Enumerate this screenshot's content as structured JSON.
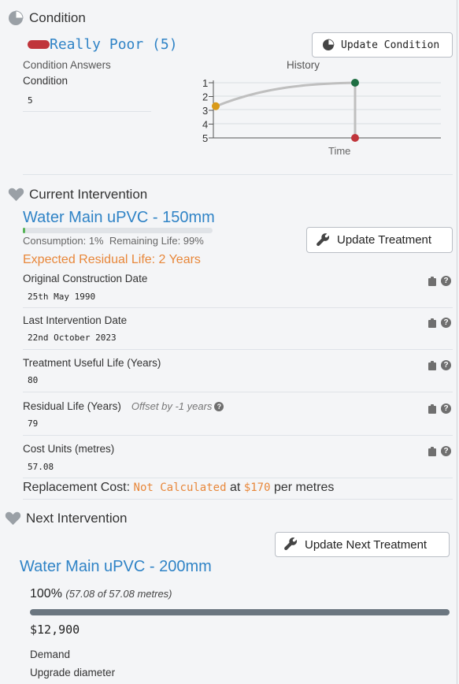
{
  "condition": {
    "title": "Condition",
    "status": "Really Poor (5)",
    "status_color": "#c0353b",
    "update_button": "Update Condition",
    "answers_label": "Condition Answers",
    "field_label": "Condition",
    "field_value": "5",
    "history": {
      "title": "History",
      "y_ticks": [
        "1",
        "2",
        "3",
        "4",
        "5"
      ],
      "x_label": "Time",
      "points": [
        {
          "value": 2.7,
          "color": "#d99a1a"
        },
        {
          "value": 1,
          "color": "#1f6f43"
        },
        {
          "value": 5,
          "color": "#c0353b"
        }
      ]
    }
  },
  "current": {
    "title": "Current Intervention",
    "name": "Water Main uPVC - 150mm",
    "consumption": "Consumption: 1%",
    "remaining": "Remaining Life: 99%",
    "consumption_pct": 1,
    "update_button": "Update Treatment",
    "expected": "Expected Residual Life: 2 Years",
    "expected_color": "#e8873a",
    "fields": [
      {
        "label": "Original Construction Date",
        "value": "25th May 1990"
      },
      {
        "label": "Last Intervention Date",
        "value": "22nd October 2023"
      },
      {
        "label": "Treatment Useful Life (Years)",
        "value": "80"
      },
      {
        "label": "Residual Life (Years)",
        "note": "Offset by -1 years",
        "value": "79"
      },
      {
        "label": "Cost Units (metres)",
        "value": "57.08"
      }
    ],
    "replacement": {
      "prefix": "Replacement Cost:",
      "status": "Not Calculated",
      "middle": "at",
      "rate": "$170",
      "suffix": "per metres"
    }
  },
  "next": {
    "title": "Next Intervention",
    "update_button": "Update Next Treatment",
    "name": "Water Main uPVC - 200mm",
    "percent": "100%",
    "percent_detail": "(57.08 of 57.08 metres)",
    "progress": 1.0,
    "cost": "$12,900",
    "demand_label": "Demand",
    "demand_value": "Upgrade diameter"
  },
  "colors": {
    "accent_blue": "#2f83c6",
    "orange": "#e8873a",
    "icon_grey": "#6f6f6f"
  }
}
